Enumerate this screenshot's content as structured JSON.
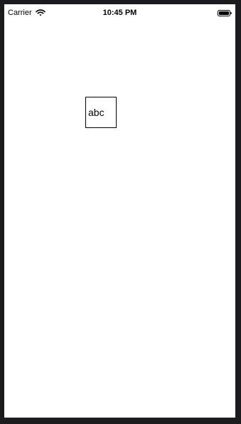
{
  "status_bar": {
    "carrier": "Carrier",
    "time": "10:45 PM",
    "icons": {
      "wifi": "wifi-icon",
      "battery": "battery-icon"
    }
  },
  "content": {
    "box_text": "abc"
  },
  "colors": {
    "device_bezel": "#1c1c1e",
    "screen_background": "#ffffff",
    "text": "#000000",
    "box_border": "#000000"
  }
}
